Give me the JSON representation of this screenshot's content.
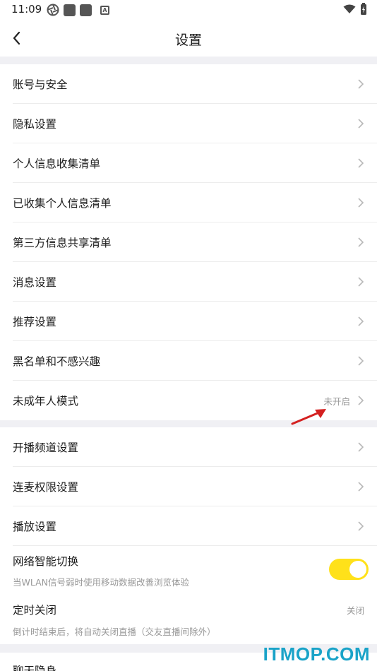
{
  "status_bar": {
    "time": "11:09"
  },
  "header": {
    "title": "设置"
  },
  "group1": [
    {
      "label": "账号与安全"
    },
    {
      "label": "隐私设置"
    },
    {
      "label": "个人信息收集清单"
    },
    {
      "label": "已收集个人信息清单"
    },
    {
      "label": "第三方信息共享清单"
    },
    {
      "label": "消息设置"
    },
    {
      "label": "推荐设置"
    },
    {
      "label": "黑名单和不感兴趣"
    },
    {
      "label": "未成年人模式",
      "value": "未开启"
    }
  ],
  "group2": [
    {
      "label": "开播频道设置"
    },
    {
      "label": "连麦权限设置"
    },
    {
      "label": "播放设置"
    }
  ],
  "network_switch": {
    "label": "网络智能切换",
    "desc": "当WLAN信号弱时使用移动数据改善浏览体验",
    "enabled": true
  },
  "timer_off": {
    "label": "定时关闭",
    "desc": "倒计时结束后，将自动关闭直播（交友直播间除外）",
    "value": "关闭"
  },
  "partial_row": {
    "label": "聊天隐身"
  },
  "watermark": "ITMOP.COM",
  "colors": {
    "toggle_on": "#ffe11a",
    "section_gap": "#f0f0f4",
    "annotation_arrow": "#d42020",
    "watermark": "#1aa3c8"
  },
  "icons": [
    "back-arrow-icon",
    "chevron-right-icon",
    "wifi-icon",
    "battery-icon"
  ]
}
